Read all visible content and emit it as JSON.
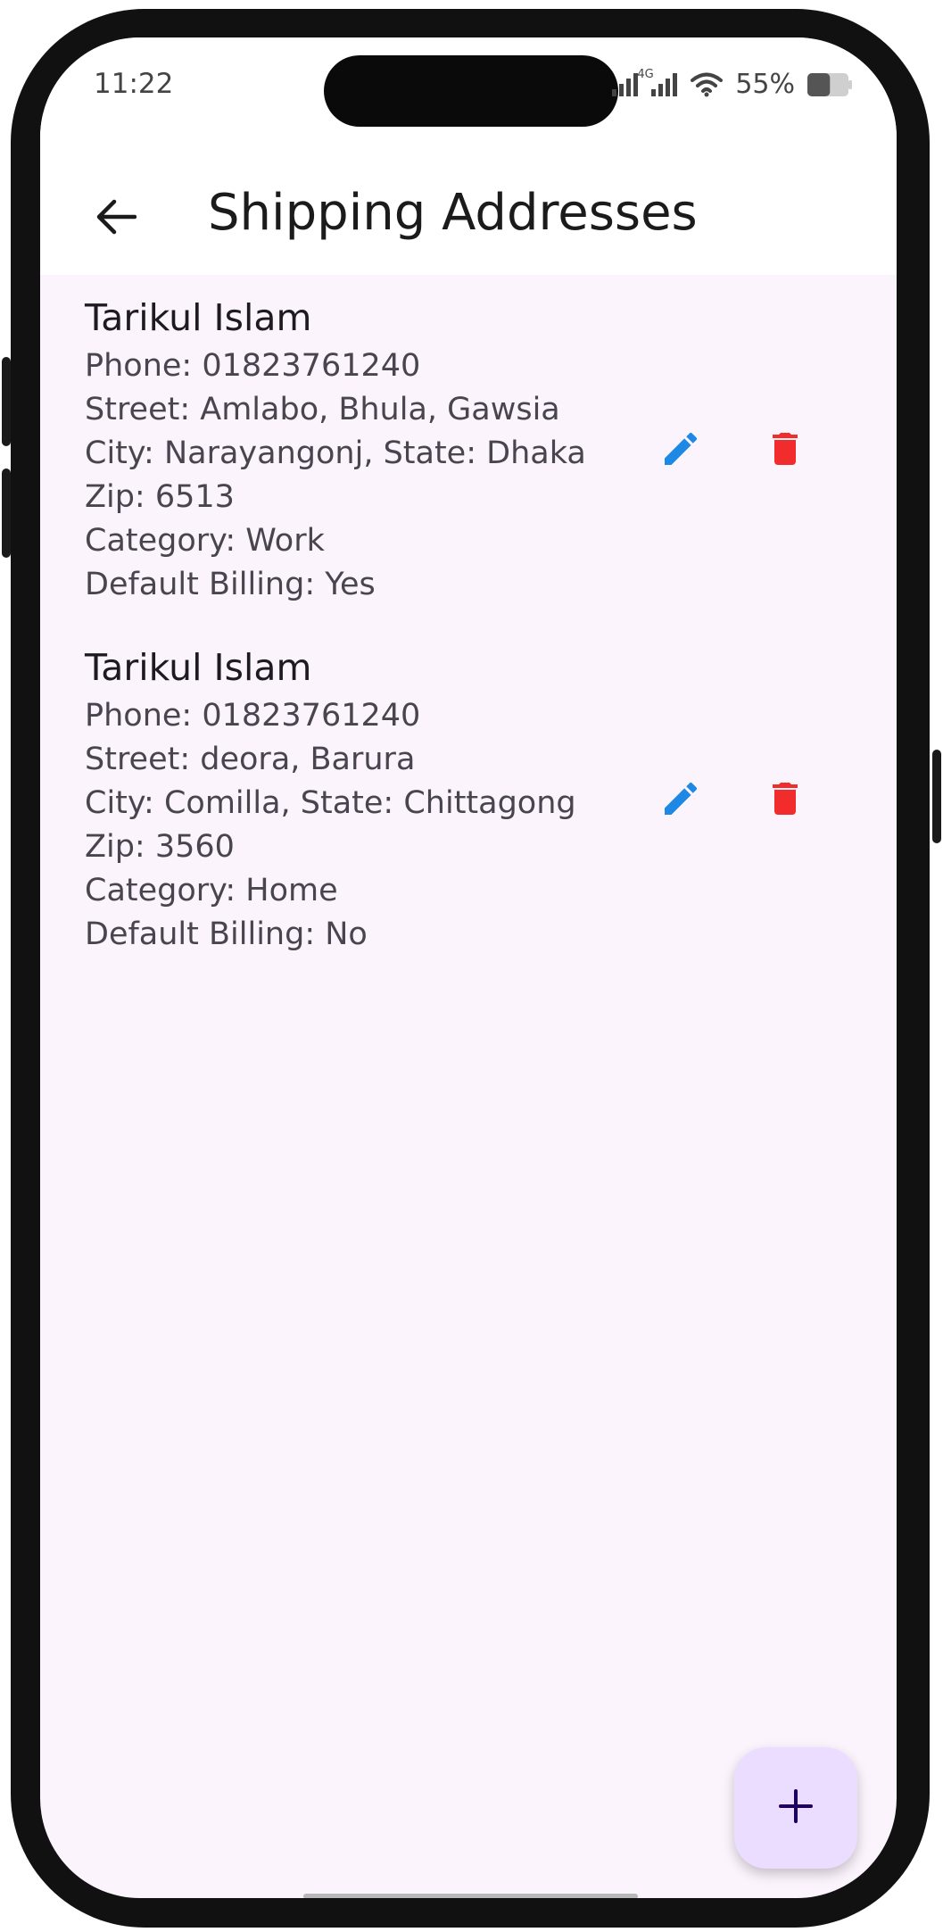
{
  "status_bar": {
    "time": "11:22",
    "network_label": "4G",
    "battery_percent": "55%",
    "battery_level": 0.55
  },
  "appbar": {
    "title": "Shipping Addresses",
    "back_icon": "arrow-back-icon"
  },
  "addresses": [
    {
      "name": "Tarikul Islam",
      "phone": "Phone: 01823761240",
      "street": "Street: Amlabo, Bhula, Gawsia",
      "city_state": "City: Narayangonj, State: Dhaka",
      "zip": "Zip: 6513",
      "category": "Category: Work",
      "default_billing": "Default Billing: Yes"
    },
    {
      "name": "Tarikul Islam",
      "phone": "Phone: 01823761240",
      "street": "Street: deora, Barura",
      "city_state": "City: Comilla, State: Chittagong",
      "zip": "Zip: 3560",
      "category": "Category: Home",
      "default_billing": "Default Billing: No"
    }
  ],
  "icons": {
    "edit": "pencil-icon",
    "delete": "trash-icon",
    "add": "plus-icon"
  },
  "colors": {
    "edit_icon": "#1e88e5",
    "delete_icon": "#f22c2c",
    "fab_background": "#eaddff",
    "fab_icon": "#21005d",
    "background": "#fcf4fd"
  }
}
